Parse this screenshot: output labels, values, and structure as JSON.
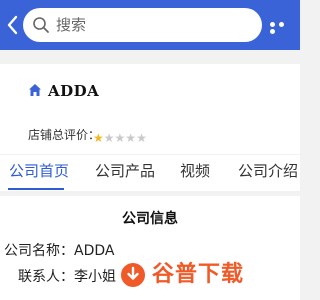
{
  "header": {
    "search_placeholder": "搜索",
    "back_icon": "chevron-left-icon",
    "more_icon": "more-dots-icon",
    "bar_color": "#3a63d8"
  },
  "store": {
    "name": "ADDA",
    "rating_label": "店铺总评价：",
    "rating": 1,
    "rating_max": 5
  },
  "tabs": [
    {
      "label": "公司首页",
      "active": true
    },
    {
      "label": "公司产品",
      "active": false
    },
    {
      "label": "视频",
      "active": false
    },
    {
      "label": "公司介绍",
      "active": false
    }
  ],
  "company_info": {
    "title": "公司信息",
    "rows": [
      {
        "key": "公司名称：",
        "value": "ADDA"
      },
      {
        "key": "联系人：",
        "value": "李小姐"
      }
    ]
  },
  "watermark": {
    "text": "谷普下载",
    "color": "#f05a28"
  }
}
